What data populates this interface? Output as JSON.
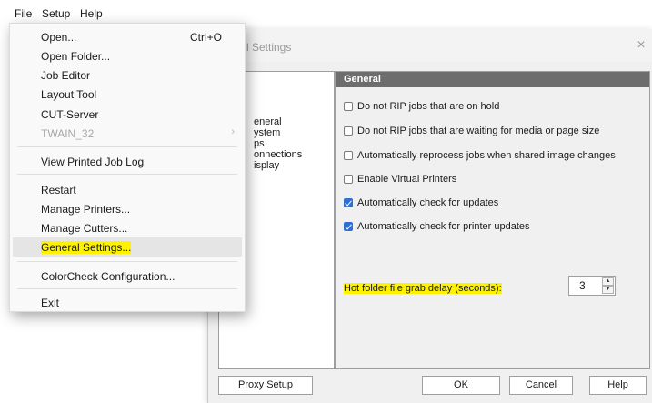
{
  "menubar": {
    "items": [
      {
        "label": "File"
      },
      {
        "label": "Setup"
      },
      {
        "label": "Help"
      }
    ]
  },
  "file_menu": {
    "open": {
      "label": "Open...",
      "shortcut": "Ctrl+O"
    },
    "open_folder": {
      "label": "Open Folder..."
    },
    "job_editor": {
      "label": "Job Editor"
    },
    "layout_tool": {
      "label": "Layout Tool"
    },
    "cut_server": {
      "label": "CUT-Server"
    },
    "twain": {
      "label": "TWAIN_32",
      "disabled": true
    },
    "view_log": {
      "label": "View Printed Job Log"
    },
    "restart": {
      "label": "Restart"
    },
    "manage_printers": {
      "label": "Manage Printers..."
    },
    "manage_cutters": {
      "label": "Manage Cutters..."
    },
    "general_settings": {
      "label": "General Settings...",
      "highlighted": true
    },
    "colorcheck": {
      "label": "ColorCheck Configuration..."
    },
    "exit": {
      "label": "Exit"
    }
  },
  "dialog": {
    "title": "l Settings",
    "close_glyph": "×",
    "nav": [
      "eneral",
      "ystem",
      "ps",
      "onnections",
      "isplay"
    ],
    "panel_title": "General",
    "options": [
      {
        "label": "Do not RIP jobs that are on hold",
        "checked": false
      },
      {
        "label": "Do not RIP jobs that are waiting for media or page size",
        "checked": false
      },
      {
        "label": "Automatically reprocess jobs when shared image changes",
        "checked": false
      },
      {
        "label": "Enable Virtual Printers",
        "checked": false
      },
      {
        "label": "Automatically check for updates",
        "checked": true
      },
      {
        "label": "Automatically check for printer updates",
        "checked": true
      }
    ],
    "delay_label": "Hot folder file grab delay (seconds):",
    "delay_value": "3",
    "buttons": {
      "proxy": "Proxy Setup",
      "ok": "OK",
      "cancel": "Cancel",
      "help": "Help"
    }
  },
  "colors": {
    "highlight": "#fff200",
    "checked": "#2f6fd1",
    "panel_header": "#6d6d6d"
  }
}
